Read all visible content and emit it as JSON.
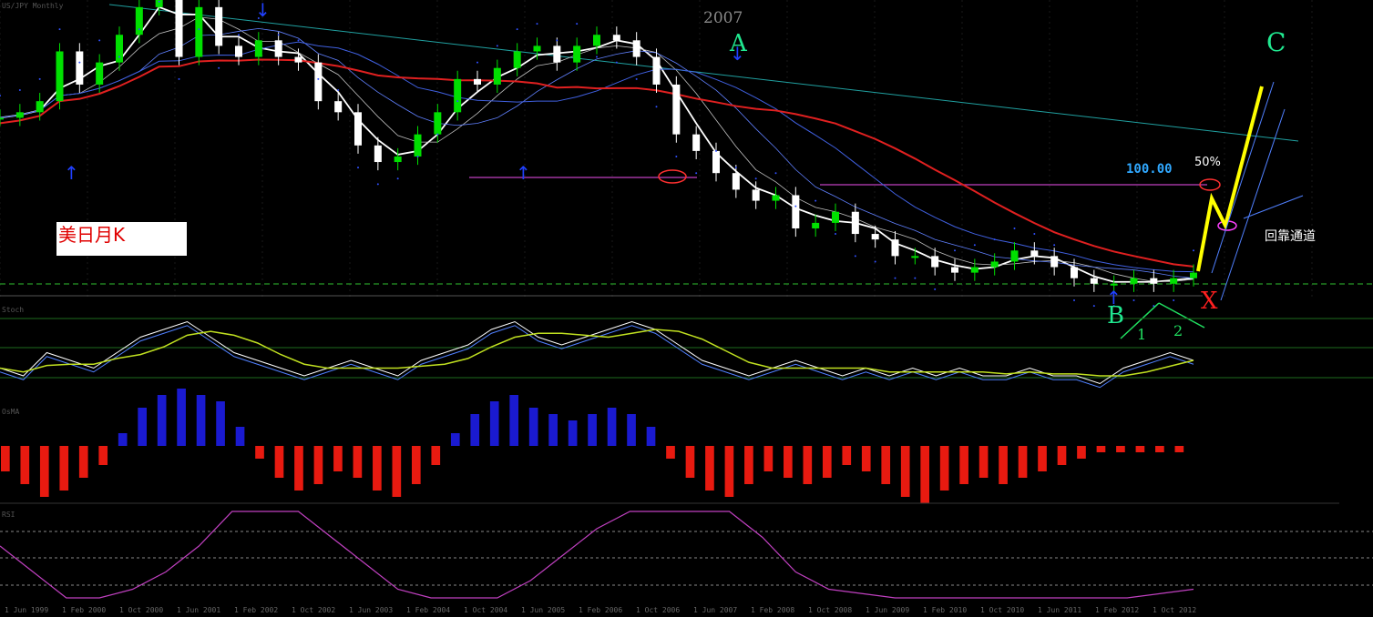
{
  "chart_title": "美日月K",
  "year_label": "2007",
  "wave_labels": {
    "A": "A",
    "B": "B",
    "C": "C",
    "X": "X",
    "one": "1",
    "two": "2"
  },
  "target_label": "100.00",
  "pct_label": "50%",
  "channel_label": "回靠通道",
  "x_ticks": [
    "1 Jun 1999",
    "1 Feb 2000",
    "1 Oct 2000",
    "1 Jun 2001",
    "1 Feb 2002",
    "1 Oct 2002",
    "1 Jun 2003",
    "1 Feb 2004",
    "1 Oct 2004",
    "1 Jun 2005",
    "1 Feb 2006",
    "1 Oct 2006",
    "1 Jun 2007",
    "1 Feb 2008",
    "1 Oct 2008",
    "1 Jun 2009",
    "1 Feb 2010",
    "1 Oct 2010",
    "1 Jun 2011",
    "1 Feb 2012",
    "1 Oct 2012"
  ],
  "colors": {
    "up_candle": "#00e000",
    "down_candle": "#ffffff",
    "macd_pos": "#1a1ad0",
    "macd_neg": "#e81a10",
    "ma_long": "#e02020",
    "ma_short": "#ffffff",
    "forecast": "#ffff00",
    "wave_label": "#20e890",
    "rsi": "#c040c0",
    "fib_line": "#c040c0"
  },
  "chart_data": {
    "type": "candlestick",
    "title": "美日月K",
    "y_reference": 100.0,
    "approx_close": [
      107,
      108,
      110,
      119,
      113,
      117,
      122,
      127,
      132,
      118,
      127,
      120,
      118,
      121,
      118,
      117,
      110,
      108,
      102,
      99,
      100,
      104,
      108,
      114,
      113,
      116,
      119,
      120,
      117,
      120,
      122,
      121,
      118,
      113,
      104,
      101,
      97,
      94,
      92,
      93,
      87,
      88,
      90,
      86,
      85,
      82,
      82,
      80,
      79,
      80,
      81,
      83,
      82,
      80,
      78,
      77,
      77,
      78,
      77,
      78,
      79
    ],
    "macd_hist": [
      -4,
      -6,
      -8,
      -7,
      -5,
      -3,
      2,
      6,
      8,
      9,
      8,
      7,
      3,
      -2,
      -5,
      -7,
      -6,
      -4,
      -5,
      -7,
      -8,
      -6,
      -3,
      2,
      5,
      7,
      8,
      6,
      5,
      4,
      5,
      6,
      5,
      3,
      -2,
      -5,
      -7,
      -8,
      -6,
      -4,
      -5,
      -6,
      -5,
      -3,
      -4,
      -6,
      -8,
      -9,
      -7,
      -6,
      -5,
      -6,
      -5,
      -4,
      -3,
      -2,
      -1,
      -1,
      -1,
      -1,
      -1
    ],
    "stoch": [
      0.3,
      0.2,
      0.5,
      0.4,
      0.3,
      0.5,
      0.7,
      0.8,
      0.9,
      0.7,
      0.5,
      0.4,
      0.3,
      0.2,
      0.3,
      0.4,
      0.3,
      0.2,
      0.4,
      0.5,
      0.6,
      0.8,
      0.9,
      0.7,
      0.6,
      0.7,
      0.8,
      0.9,
      0.8,
      0.6,
      0.4,
      0.3,
      0.2,
      0.3,
      0.4,
      0.3,
      0.2,
      0.3,
      0.2,
      0.3,
      0.2,
      0.3,
      0.2,
      0.2,
      0.3,
      0.2,
      0.2,
      0.1,
      0.3,
      0.4,
      0.5,
      0.4
    ],
    "rsi_panel": [
      0.6,
      0.3,
      0.0,
      0.0,
      0.1,
      0.3,
      0.6,
      1.0,
      1.0,
      1.0,
      0.7,
      0.4,
      0.1,
      0.0,
      0.0,
      0.0,
      0.2,
      0.5,
      0.8,
      1.0,
      1.0,
      1.0,
      1.0,
      0.7,
      0.3,
      0.1,
      0.05,
      0.0,
      0.0,
      0.0,
      0.0,
      0.0,
      0.0,
      0.0,
      0.0,
      0.05,
      0.1
    ]
  }
}
